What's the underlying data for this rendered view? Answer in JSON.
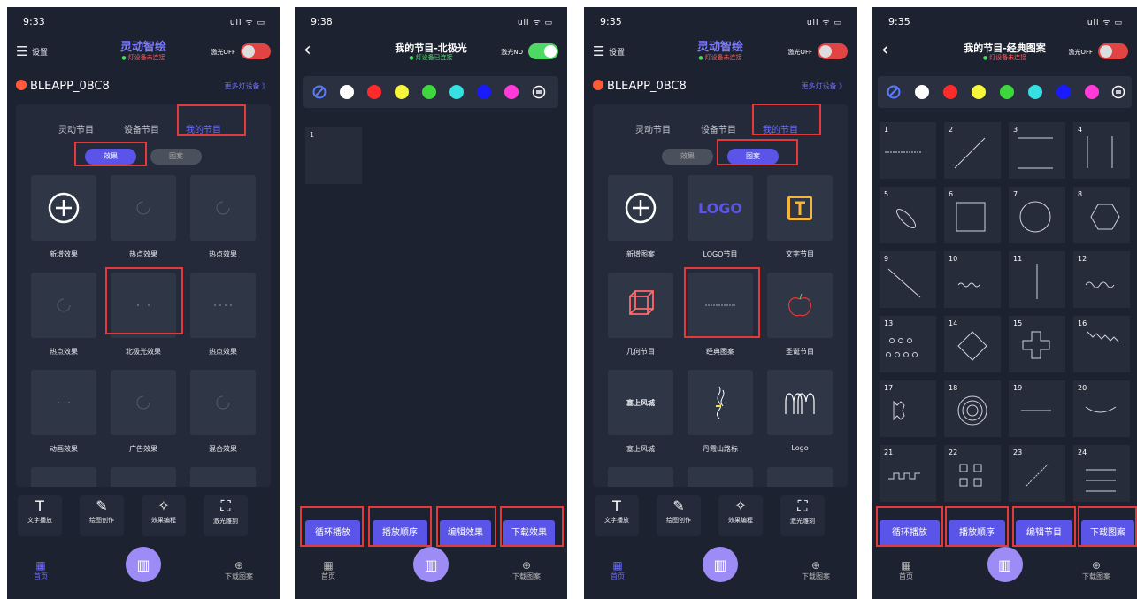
{
  "p1": {
    "time": "9:33",
    "status": "ull ᯤ ▭",
    "menu": "设置",
    "title": "灵动智绘",
    "subtitle": "灯设备未连接",
    "toggle_label": "激光OFF",
    "device": "BLEAPP_0BC8",
    "more": "更多灯设备 》",
    "tabs": [
      "灵动节目",
      "设备节目",
      "我的节目"
    ],
    "pill_on": "效果",
    "pill_off": "图案",
    "cells": [
      "新增效果",
      "热点效果",
      "热点效果",
      "热点效果",
      "北极光效果",
      "热点效果",
      "动画效果",
      "广告效果",
      "混合效果"
    ],
    "tools": [
      "文字播放",
      "绘图创作",
      "效果编程",
      "激光雕刻"
    ],
    "nav_home": "首页",
    "nav_dl": "下载图案"
  },
  "p2": {
    "time": "9:38",
    "status": "ull ᯤ ▭",
    "title": "我的节目-北极光",
    "subtitle": "灯设备已连接",
    "toggle_label": "激光NO",
    "item": "1",
    "buttons": [
      "循环播放",
      "播放顺序",
      "编辑效果",
      "下载效果"
    ],
    "nav_home": "首页",
    "nav_dl": "下载图案"
  },
  "p3": {
    "time": "9:35",
    "status": "ull ᯤ ▭",
    "menu": "设置",
    "title": "灵动智绘",
    "subtitle": "灯设备未连接",
    "toggle_label": "激光OFF",
    "device": "BLEAPP_0BC8",
    "more": "更多灯设备 》",
    "tabs": [
      "灵动节目",
      "设备节目",
      "我的节目"
    ],
    "pill_off": "效果",
    "pill_on": "图案",
    "cells": [
      "新增图案",
      "LOGO节目",
      "文字节目",
      "几何节目",
      "经典图案",
      "圣诞节目",
      "塞上风城",
      "丹霞山路标",
      "Logo"
    ],
    "logo_text": "LOGO",
    "city_text": "塞上风城",
    "tools": [
      "文字播放",
      "绘图创作",
      "效果编程",
      "激光雕刻"
    ],
    "nav_home": "首页",
    "nav_dl": "下载图案"
  },
  "p4": {
    "time": "9:35",
    "status": "ull ᯤ ▭",
    "title": "我的节目-经典图案",
    "subtitle": "灯设备未连接",
    "toggle_label": "激光OFF",
    "numbers": [
      "1",
      "2",
      "3",
      "4",
      "5",
      "6",
      "7",
      "8",
      "9",
      "10",
      "11",
      "12",
      "13",
      "14",
      "15",
      "16",
      "17",
      "18",
      "19",
      "20",
      "21",
      "22",
      "23",
      "24"
    ],
    "buttons": [
      "循环播放",
      "播放顺序",
      "编辑节目",
      "下载图案"
    ],
    "nav_home": "首页",
    "nav_dl": "下载图案"
  },
  "colors": [
    "#ffffff",
    "#ff2b2b",
    "#f5f53a",
    "#3ed83e",
    "#35e0e0",
    "#1a1aff",
    "#ff3ad8"
  ],
  "accent": "#5a55e8",
  "highlight": "#e23a3a"
}
